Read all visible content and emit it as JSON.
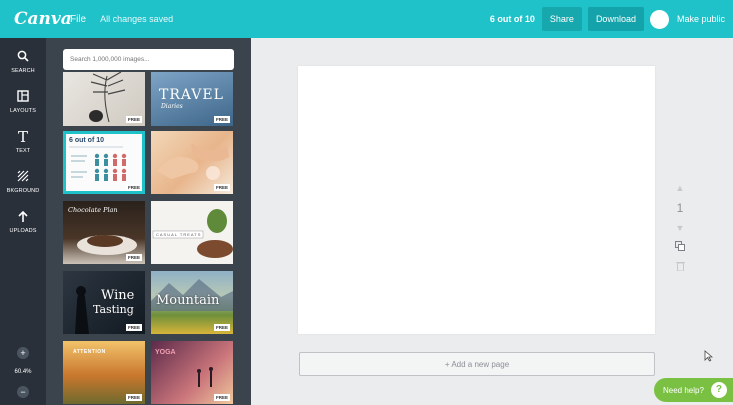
{
  "topbar": {
    "logo": "Canva",
    "file_menu": "File",
    "save_status": "All changes saved",
    "design_count": "6 out of 10",
    "share_label": "Share",
    "download_label": "Download",
    "publish_label": "Make public"
  },
  "rail": {
    "items": [
      {
        "label": "SEARCH",
        "icon": "search-icon"
      },
      {
        "label": "LAYOUTS",
        "icon": "layouts-icon"
      },
      {
        "label": "TEXT",
        "icon": "text-icon"
      },
      {
        "label": "BKGROUND",
        "icon": "background-icon"
      },
      {
        "label": "UPLOADS",
        "icon": "uploads-icon"
      }
    ],
    "zoom_in": "+",
    "zoom_out": "−",
    "zoom_level": "60.4%"
  },
  "panel": {
    "search_placeholder": "Search 1,000,000 images...",
    "free_tag": "FREE",
    "thumbs": [
      {
        "name": "peacock-feather",
        "text": ""
      },
      {
        "name": "travel-diaries",
        "text": "TRAVEL",
        "sub": "Diaries"
      },
      {
        "name": "infographic",
        "text": "6 out of 10"
      },
      {
        "name": "hands-nails",
        "text": ""
      },
      {
        "name": "chocolate-plan",
        "text": "Chocolate Plan"
      },
      {
        "name": "holiday-feast",
        "text": "CASUAL TREATS"
      },
      {
        "name": "wine-tasting",
        "text": "Wine",
        "sub": "Tasting"
      },
      {
        "name": "mountain",
        "text": "Mountain"
      },
      {
        "name": "sunset-field",
        "text": "ATTENTION"
      },
      {
        "name": "yoga",
        "text": "YOGA"
      }
    ]
  },
  "canvas": {
    "page_number": "1",
    "add_page_label": "+ Add a new page"
  },
  "help": {
    "label": "Need help?",
    "icon_text": "?"
  },
  "colors": {
    "accent": "#1fc2c9",
    "rail": "#293039",
    "panel": "#3b434d",
    "help": "#7ac143"
  }
}
